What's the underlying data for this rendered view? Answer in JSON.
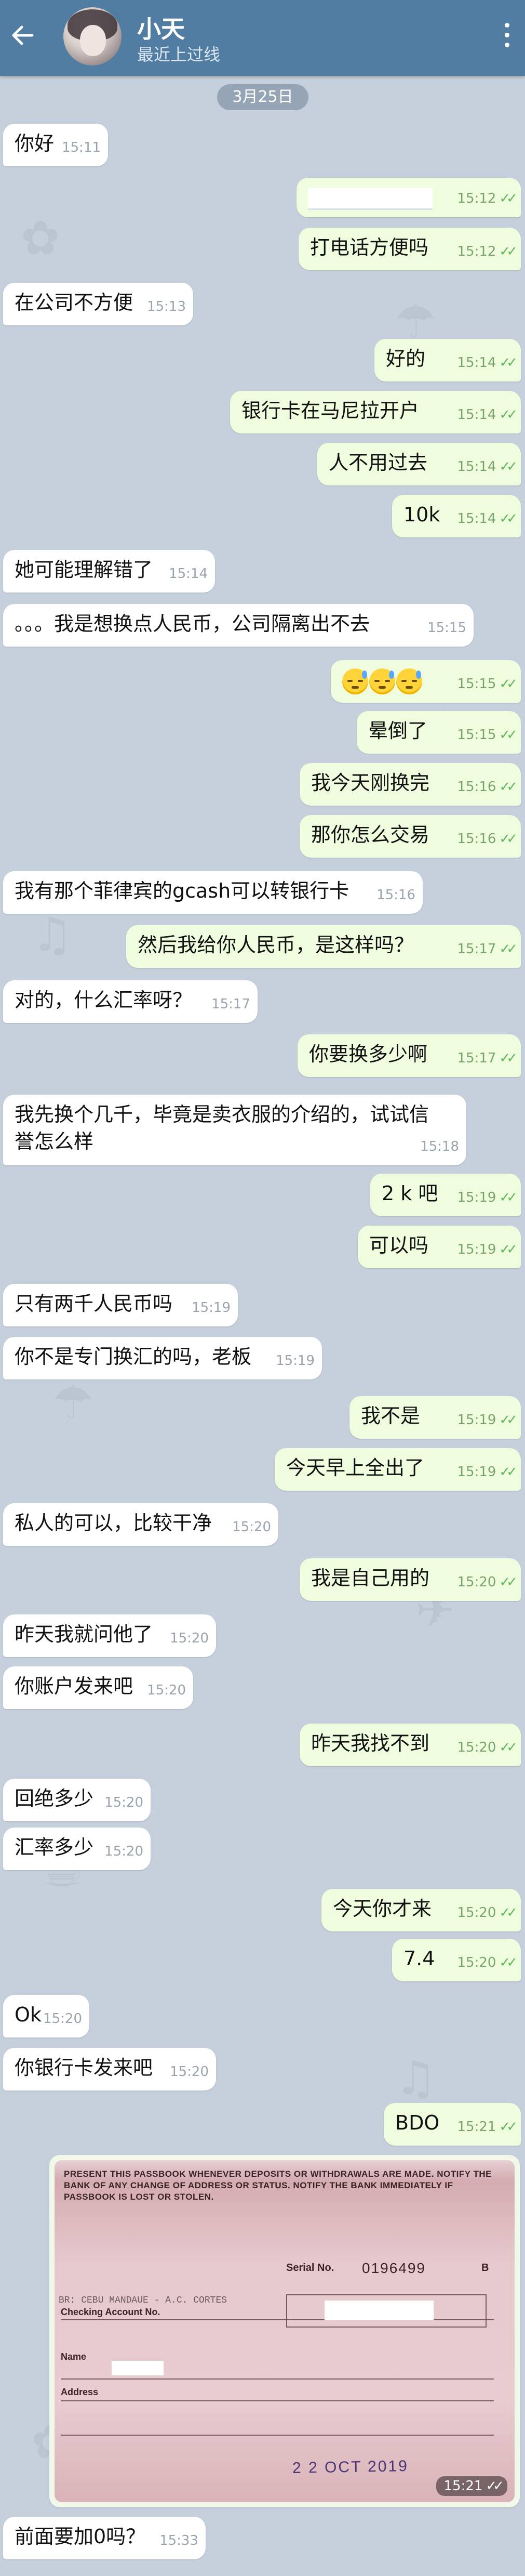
{
  "header": {
    "title": "小天",
    "status": "最近上过线"
  },
  "date_chip": "3月25日",
  "messages": [
    {
      "text": "你好",
      "time": "15:11"
    },
    {
      "text": "",
      "time": "15:12"
    },
    {
      "text": "打电话方便吗",
      "time": "15:12"
    },
    {
      "text": "在公司不方便",
      "time": "15:13"
    },
    {
      "text": "好的",
      "time": "15:14"
    },
    {
      "text": "银行卡在马尼拉开户",
      "time": "15:14"
    },
    {
      "text": "人不用过去",
      "time": "15:14"
    },
    {
      "text": "10k",
      "time": "15:14"
    },
    {
      "text": "她可能理解错了",
      "time": "15:14"
    },
    {
      "text": "。。。我是想换点人民币，公司隔离出不去",
      "time": "15:15"
    },
    {
      "text": "",
      "time": "15:15"
    },
    {
      "text": "晕倒了",
      "time": "15:15"
    },
    {
      "text": "我今天刚换完",
      "time": "15:16"
    },
    {
      "text": "那你怎么交易",
      "time": "15:16"
    },
    {
      "text": "我有那个菲律宾的gcash可以转银行卡",
      "time": "15:16"
    },
    {
      "text": "然后我给你人民币，是这样吗？",
      "time": "15:17"
    },
    {
      "text": "对的，什么汇率呀？",
      "time": "15:17"
    },
    {
      "text": "你要换多少啊",
      "time": "15:17"
    },
    {
      "text": "我先换个几千，毕竟是卖衣服的介绍的，试试信誉怎么样",
      "time": "15:18"
    },
    {
      "text": "2 k 吧",
      "time": "15:19"
    },
    {
      "text": "可以吗",
      "time": "15:19"
    },
    {
      "text": "只有两千人民币吗",
      "time": "15:19"
    },
    {
      "text": "你不是专门换汇的吗，老板",
      "time": "15:19"
    },
    {
      "text": "我不是",
      "time": "15:19"
    },
    {
      "text": "今天早上全出了",
      "time": "15:19"
    },
    {
      "text": "私人的可以，比较干净",
      "time": "15:20"
    },
    {
      "text": "我是自己用的",
      "time": "15:20"
    },
    {
      "text": "昨天我就问他了",
      "time": "15:20"
    },
    {
      "text": "你账户发来吧",
      "time": "15:20"
    },
    {
      "text": "昨天我找不到",
      "time": "15:20"
    },
    {
      "text": "回绝多少",
      "time": "15:20"
    },
    {
      "text": "汇率多少",
      "time": "15:20"
    },
    {
      "text": "今天你才来",
      "time": "15:20"
    },
    {
      "text": "7.4",
      "time": "15:20"
    },
    {
      "text": "Ok",
      "time": "15:20"
    },
    {
      "text": "你银行卡发来吧",
      "time": "15:20"
    },
    {
      "text": "BDO",
      "time": "15:21"
    },
    {
      "text": "前面要加0吗？",
      "time": "15:33"
    }
  ],
  "photo": {
    "time": "15:21",
    "warning": "PRESENT THIS PASSBOOK WHENEVER DEPOSITS OR WITHDRAWALS ARE MADE. NOTIFY THE BANK OF ANY CHANGE OF ADDRESS OR STATUS. NOTIFY THE BANK IMMEDIATELY IF PASSBOOK IS LOST OR STOLEN.",
    "serial_label": "Serial No.",
    "serial_value": "0196499",
    "serial_suffix": "B",
    "checking_label": "Checking Account No.",
    "account_line": "BR: CEBU MANDAUE - A.C. CORTES",
    "name_label": "Name",
    "address_label": "Address",
    "date_stamp": "2 2 OCT 2019"
  },
  "ticks": "✓✓"
}
